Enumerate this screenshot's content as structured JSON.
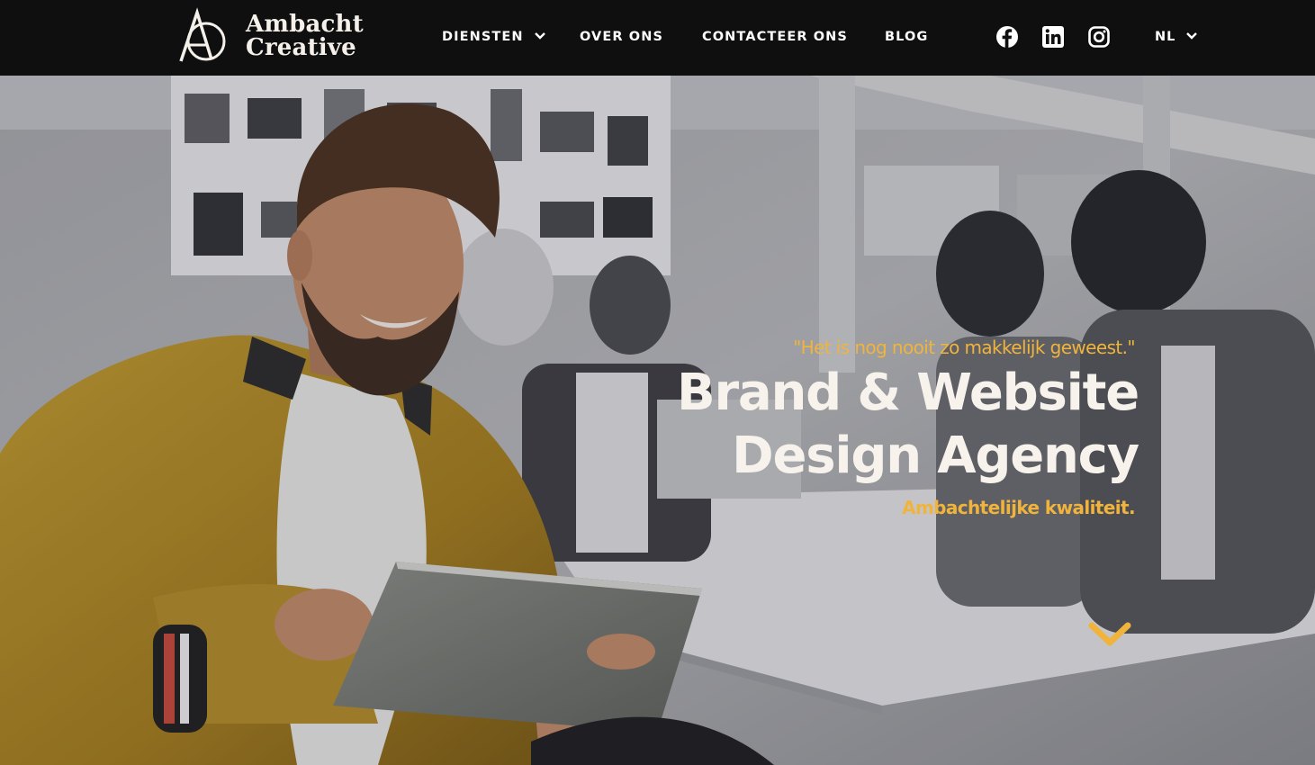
{
  "brand": {
    "name_line1": "Ambacht",
    "name_line2": "Creative",
    "monogram": "AC"
  },
  "nav": {
    "items": [
      {
        "label": "DIENSTEN",
        "has_dropdown": true
      },
      {
        "label": "OVER ONS",
        "has_dropdown": false
      },
      {
        "label": "CONTACTEER ONS",
        "has_dropdown": false
      },
      {
        "label": "BLOG",
        "has_dropdown": false
      }
    ],
    "social": [
      "facebook-icon",
      "linkedin-icon",
      "instagram-icon"
    ],
    "language": "NL"
  },
  "hero": {
    "quote": "\"Het is nog nooit zo makkelijk geweest.\"",
    "headline_line1": "Brand & Website",
    "headline_line2": "Design Agency",
    "subline": "Ambachtelijke kwaliteit.",
    "scroll_icon": "chevron-down-icon"
  },
  "colors": {
    "navbar_bg": "#0f0f0f",
    "accent": "#f0b43c",
    "headline": "#f7f3ec"
  }
}
